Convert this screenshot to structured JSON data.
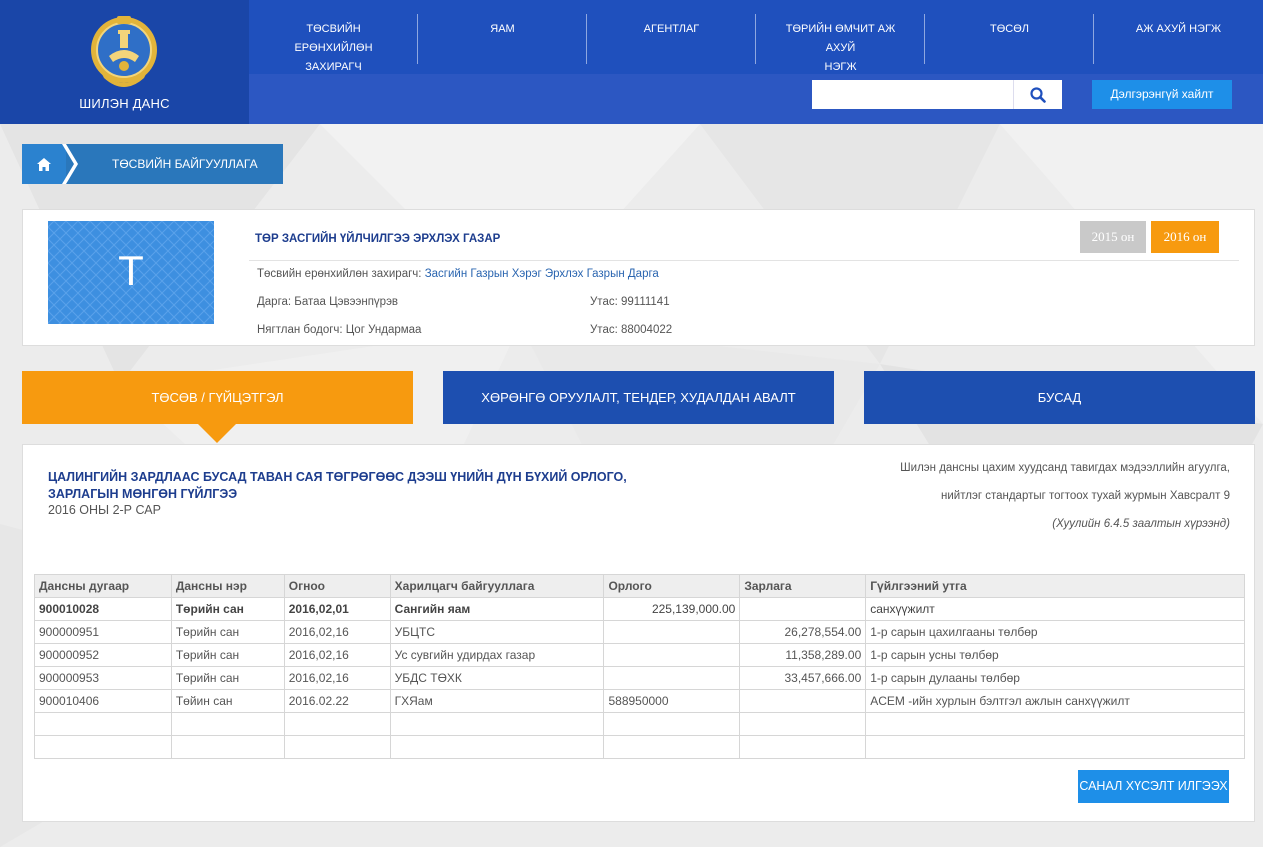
{
  "brand": {
    "name": "ШИЛЭН ДАНС",
    "colors": {
      "primary": "#1f50bd",
      "accent": "#f79a0f",
      "button": "#1e8fe8",
      "dark_tab": "#1d4fb0"
    }
  },
  "top_nav": [
    {
      "label_1": "ТӨСВИЙН ЕРӨНХИЙЛӨН",
      "label_2": "ЗАХИРАГЧ"
    },
    {
      "label_1": "ЯАМ",
      "label_2": ""
    },
    {
      "label_1": "АГЕНТЛАГ",
      "label_2": ""
    },
    {
      "label_1": "ТӨРИЙН ӨМЧИТ АЖ АХУЙ",
      "label_2": "НЭГЖ"
    },
    {
      "label_1": "ТӨСӨЛ",
      "label_2": ""
    },
    {
      "label_1": "АЖ АХУЙ НЭГЖ",
      "label_2": ""
    }
  ],
  "search": {
    "value": "",
    "placeholder": "",
    "icon": "search-icon",
    "advanced_label": "Дэлгэрэнгүй хайлт"
  },
  "breadcrumb": {
    "home_icon": "home-icon",
    "current": "ТӨСВИЙН БАЙГУУЛЛАГА"
  },
  "org": {
    "logo_letter": "Т",
    "name": "ТӨР ЗАСГИЙН ҮЙЛЧИЛГЭЭ ЭРХЛЭХ ГАЗАР",
    "manager_label": "Төсвийн ерөнхийлөн захирагч:",
    "manager_value": "Засгийн Газрын Хэрэг Эрхлэх Газрын Дарга",
    "head": "Дарга: Батаа Цэвээнпүрэв",
    "head_phone": "Утас: 99111141",
    "accountant": "Нягтлан бодогч: Цог Ундармаа",
    "accountant_phone": "Утас: 88004022",
    "years": [
      {
        "label": "2015 он",
        "active": false
      },
      {
        "label": "2016 он",
        "active": true
      }
    ]
  },
  "tabs": [
    {
      "label": "ТӨСӨВ / ГҮЙЦЭТГЭЛ",
      "active": true
    },
    {
      "label": "ХӨРӨНГӨ ОРУУЛАЛТ, ТЕНДЕР, ХУДАЛДАН АВАЛТ",
      "active": false
    },
    {
      "label": "БУСАД",
      "active": false
    }
  ],
  "panel": {
    "title_1": "ЦАЛИНГИЙН ЗАРДЛААС БУСАД ТАВАН САЯ ТӨГРӨГӨӨС ДЭЭШ ҮНИЙН ДҮН БҮХИЙ ОРЛОГО,",
    "title_2": "ЗАРЛАГЫН МӨНГӨН ГҮЙЛГЭЭ",
    "subtitle": "2016 ОНЫ 2-Р САР",
    "note_1": "Шилэн дансны цахим хуудсанд тавигдах мэдээллийн агуулга,",
    "note_2": "нийтлэг стандартыг тогтоох тухай журмын Хавсралт 9",
    "note_3": "(Хуулийн 6.4.5 заалтын хүрээнд)",
    "submit_label": "САНАЛ ХҮСЭЛТ ИЛГЭЭХ"
  },
  "table": {
    "headers": [
      "Дансны дугаар",
      "Дансны нэр",
      "Огноо",
      "Харилцагч байгууллага",
      "Орлого",
      "Зарлага",
      "Гүйлгээний утга"
    ],
    "rows": [
      [
        "900010028",
        "Төрийн сан",
        "2016,02,01",
        "Сангийн яам",
        "225,139,000.00",
        "",
        "санхүүжилт"
      ],
      [
        "900000951",
        "Төрийн сан",
        "2016,02,16",
        "УБЦТС",
        "",
        "26,278,554.00",
        "1-р сарын цахилгааны төлбөр"
      ],
      [
        "900000952",
        "Төрийн сан",
        "2016,02,16",
        "Ус сувгийн удирдах газар",
        "",
        "11,358,289.00",
        "1-р сарын усны төлбөр"
      ],
      [
        "900000953",
        "Төрийн сан",
        "2016,02,16",
        "УБДС ТӨХК",
        "",
        "33,457,666.00",
        "1-р сарын дулааны төлбөр"
      ],
      [
        "900010406",
        "Төйин сан",
        "2016.02.22",
        "ГХЯам",
        "588950000",
        "",
        "ACEM -ийн хурлын бэлтгэл ажлын санхүүжилт"
      ],
      [
        "",
        "",
        "",
        "",
        "",
        "",
        ""
      ],
      [
        "",
        "",
        "",
        "",
        "",
        "",
        ""
      ]
    ]
  }
}
